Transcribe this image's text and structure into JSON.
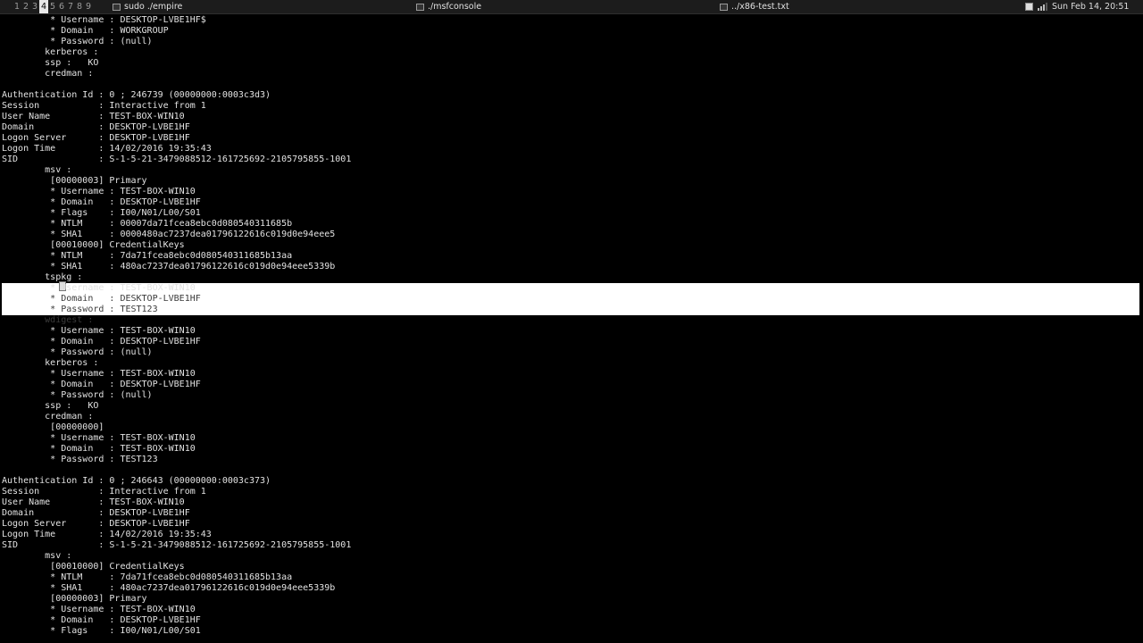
{
  "topbar": {
    "workspaces": [
      "1",
      "2",
      "3",
      "4",
      "5",
      "6",
      "7",
      "8",
      "9"
    ],
    "active_workspace": "4",
    "windows": [
      {
        "title": "sudo ./empire"
      },
      {
        "title": "./msfconsole"
      },
      {
        "title": "../x86-test.txt"
      }
    ],
    "clock": "Sun Feb 14, 20:51"
  },
  "terminal": {
    "highlight_lines": [
      26,
      27,
      28
    ],
    "lines": [
      "         * Username : DESKTOP-LVBE1HF$",
      "         * Domain   : WORKGROUP",
      "         * Password : (null)",
      "        kerberos :",
      "        ssp :   KO",
      "        credman :",
      "",
      "Authentication Id : 0 ; 246739 (00000000:0003c3d3)",
      "Session           : Interactive from 1",
      "User Name         : TEST-BOX-WIN10",
      "Domain            : DESKTOP-LVBE1HF",
      "Logon Server      : DESKTOP-LVBE1HF",
      "Logon Time        : 14/02/2016 19:35:43",
      "SID               : S-1-5-21-3479088512-161725692-2105795855-1001",
      "        msv :",
      "         [00000003] Primary",
      "         * Username : TEST-BOX-WIN10",
      "         * Domain   : DESKTOP-LVBE1HF",
      "         * Flags    : I00/N01/L00/S01",
      "         * NTLM     : 00007da71fcea8ebc0d080540311685b",
      "         * SHA1     : 0000480ac7237dea01796122616c019d0e94eee5",
      "         [00010000] CredentialKeys",
      "         * NTLM     : 7da71fcea8ebc0d080540311685b13aa",
      "         * SHA1     : 480ac7237dea01796122616c019d0e94eee5339b",
      "        tspkg :",
      "         * Username : TEST-BOX-WIN10",
      "         * Domain   : DESKTOP-LVBE1HF",
      "         * Password : TEST123",
      "        wdigest :",
      "         * Username : TEST-BOX-WIN10",
      "         * Domain   : DESKTOP-LVBE1HF",
      "         * Password : (null)",
      "        kerberos :",
      "         * Username : TEST-BOX-WIN10",
      "         * Domain   : DESKTOP-LVBE1HF",
      "         * Password : (null)",
      "        ssp :   KO",
      "        credman :",
      "         [00000000]",
      "         * Username : TEST-BOX-WIN10",
      "         * Domain   : TEST-BOX-WIN10",
      "         * Password : TEST123",
      "",
      "Authentication Id : 0 ; 246643 (00000000:0003c373)",
      "Session           : Interactive from 1",
      "User Name         : TEST-BOX-WIN10",
      "Domain            : DESKTOP-LVBE1HF",
      "Logon Server      : DESKTOP-LVBE1HF",
      "Logon Time        : 14/02/2016 19:35:43",
      "SID               : S-1-5-21-3479088512-161725692-2105795855-1001",
      "        msv :",
      "         [00010000] CredentialKeys",
      "         * NTLM     : 7da71fcea8ebc0d080540311685b13aa",
      "         * SHA1     : 480ac7237dea01796122616c019d0e94eee5339b",
      "         [00000003] Primary",
      "         * Username : TEST-BOX-WIN10",
      "         * Domain   : DESKTOP-LVBE1HF",
      "         * Flags    : I00/N01/L00/S01"
    ]
  }
}
